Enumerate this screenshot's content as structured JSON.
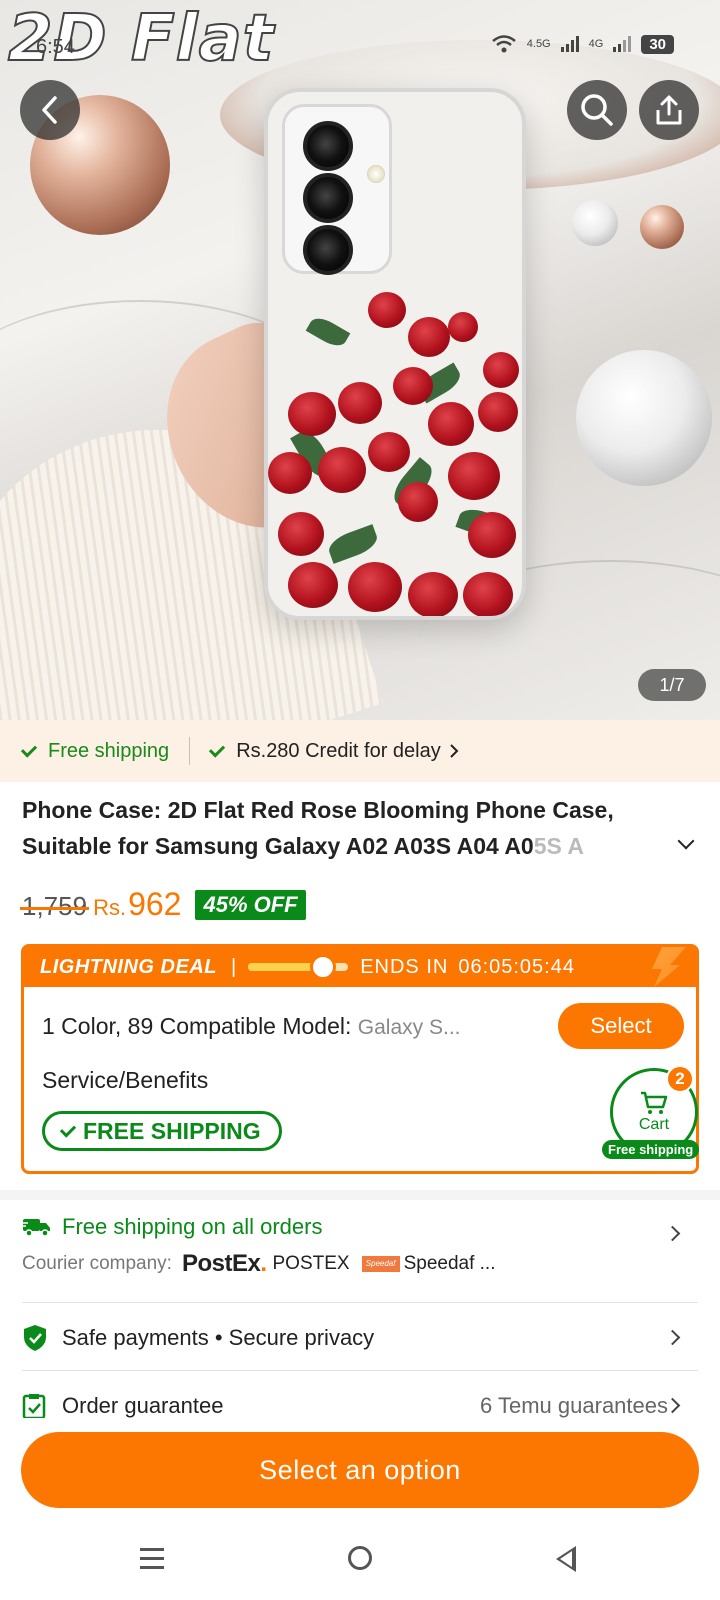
{
  "overlay": {
    "watermark": "2D Flat",
    "status_time": "6:54",
    "network_1": "4.5G",
    "network_2": "4G",
    "battery": "30"
  },
  "hero": {
    "image_counter": "1/7",
    "back_icon": "chevron-left-icon",
    "search_icon": "search-icon",
    "share_icon": "share-icon"
  },
  "banner": {
    "free_shipping": "Free shipping",
    "credit": "Rs.280 Credit for delay"
  },
  "product": {
    "title_main": "Phone Case: 2D Flat Red Rose Blooming Phone Case, Suitable for Samsung Galaxy A02 A03S A04 A0",
    "title_fade": "5S A"
  },
  "price": {
    "original": "1,759",
    "currency": "Rs.",
    "current": "962",
    "discount": "45% OFF",
    "colors": {
      "accent": "#fb7701",
      "discount_bg": "#0a8a18"
    }
  },
  "deal": {
    "label": "LIGHTNING DEAL",
    "separator": "|",
    "ends_label": "ENDS IN",
    "countdown": "06:05:05:44",
    "progress_fraction": 0.75,
    "variant_label": "1 Color, 89 Compatible Model:",
    "variant_value": "Galaxy S...",
    "select_button": "Select",
    "benefits_label": "Service/Benefits",
    "free_shipping_tag": "FREE SHIPPING"
  },
  "cart": {
    "label": "Cart",
    "count": "2",
    "note": "Free shipping"
  },
  "info": {
    "shipping_title": "Free shipping on all orders",
    "courier_label": "Courier company:",
    "courier_logo_1": "PostEx",
    "courier_logo_1_dot": ".",
    "courier_1": "POSTEX",
    "courier_logo_2": "Speedaf",
    "courier_2": "Speedaf ...",
    "safe_payments": "Safe payments • Secure privacy",
    "order_guarantee": "Order guarantee",
    "guarantee_count": "6 Temu guarantees"
  },
  "cta": {
    "label": "Select an option"
  }
}
